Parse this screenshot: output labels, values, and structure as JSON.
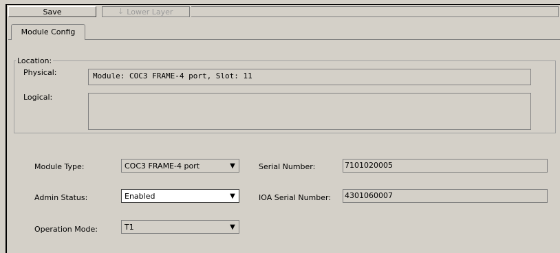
{
  "toolbar": {
    "save_label": "Save",
    "lower_layer_label": "Lower Layer",
    "lower_layer_icon": "arrow-down-icon"
  },
  "tabs": [
    {
      "label": "Module Config",
      "active": true
    }
  ],
  "location": {
    "legend": "Location:",
    "physical_label": "Physical:",
    "physical_value": "Module: COC3 FRAME-4 port, Slot: 11",
    "logical_label": "Logical:",
    "logical_value": ""
  },
  "fields": {
    "module_type_label": "Module Type:",
    "module_type_value": "COC3 FRAME-4 port",
    "admin_status_label": "Admin Status:",
    "admin_status_value": "Enabled",
    "operation_mode_label": "Operation Mode:",
    "operation_mode_value": "T1",
    "serial_number_label": "Serial Number:",
    "serial_number_value": "7101020005",
    "ioa_serial_label": "IOA Serial Number:",
    "ioa_serial_value": "4301060007"
  }
}
